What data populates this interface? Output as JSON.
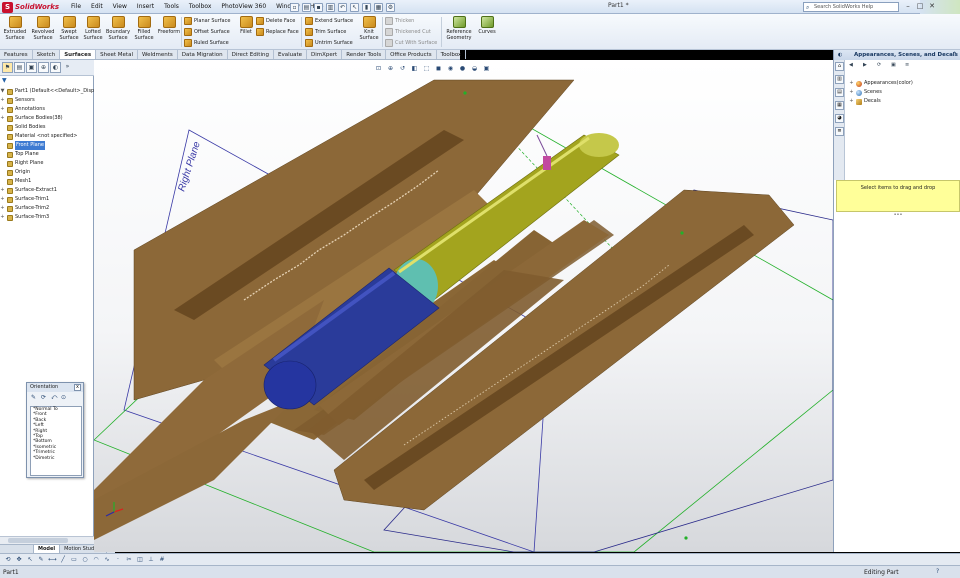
{
  "app": {
    "logo_text": "SolidWorks",
    "document_title": "Part1 *",
    "search_placeholder": "Search SolidWorks Help",
    "menu": [
      "File",
      "Edit",
      "View",
      "Insert",
      "Tools",
      "Toolbox",
      "PhotoView 360",
      "Window",
      "Help"
    ],
    "window_buttons": [
      "–",
      "□",
      "✕"
    ]
  },
  "ribbon": {
    "big_buttons": [
      {
        "label": "Extruded Surface"
      },
      {
        "label": "Revolved Surface"
      },
      {
        "label": "Swept Surface"
      },
      {
        "label": "Lofted Surface"
      },
      {
        "label": "Boundary Surface"
      },
      {
        "label": "Filled Surface"
      },
      {
        "label": "Freeform"
      }
    ],
    "col1": [
      "Planar Surface",
      "Offset Surface",
      "Ruled Surface"
    ],
    "fillet_label": "Fillet",
    "col2": [
      "Delete Face",
      "Replace Face"
    ],
    "col3": [
      "Extend Surface",
      "Trim Surface",
      "Untrim Surface"
    ],
    "knit_label": "Knit Surface",
    "col4": [
      "Thicken",
      "Thickened Cut",
      "Cut With Surface"
    ],
    "ref_geometry_label": "Reference Geometry",
    "curves_label": "Curves"
  },
  "command_tabs": [
    "Features",
    "Sketch",
    "Surfaces",
    "Sheet Metal",
    "Weldments",
    "Data Migration",
    "Direct Editing",
    "Evaluate",
    "DimXpert",
    "Render Tools",
    "Office Products",
    "Toolbox"
  ],
  "active_tab": "Surfaces",
  "feature_tree": {
    "items": [
      {
        "label": "Part1  (Default<<Default>_Disp",
        "selected": false,
        "expander": "▼"
      },
      {
        "label": "Sensors",
        "selected": false,
        "expander": "+"
      },
      {
        "label": "Annotations",
        "selected": false,
        "expander": "+"
      },
      {
        "label": "Surface Bodies(38)",
        "selected": false,
        "expander": "+"
      },
      {
        "label": "Solid Bodies",
        "selected": false,
        "expander": ""
      },
      {
        "label": "Material <not specified>",
        "selected": false,
        "expander": ""
      },
      {
        "label": "Front Plane",
        "selected": true,
        "expander": ""
      },
      {
        "label": "Top Plane",
        "selected": false,
        "expander": ""
      },
      {
        "label": "Right Plane",
        "selected": false,
        "expander": ""
      },
      {
        "label": "Origin",
        "selected": false,
        "expander": ""
      },
      {
        "label": "Mesh1",
        "selected": false,
        "expander": ""
      },
      {
        "label": "Surface-Extract1",
        "selected": false,
        "expander": "+"
      },
      {
        "label": "Surface-Trim1",
        "selected": false,
        "expander": "+"
      },
      {
        "label": "Surface-Trim2",
        "selected": false,
        "expander": "+"
      },
      {
        "label": "Surface-Trim3",
        "selected": false,
        "expander": "+"
      }
    ]
  },
  "bottom_tabs": [
    "",
    "Model",
    "Motion Study 1"
  ],
  "viewport": {
    "plane_label": "Right Plane"
  },
  "orientation": {
    "title": "Orientation",
    "close": "x",
    "views": [
      "*Normal To",
      "*Front",
      "*Back",
      "*Left",
      "*Right",
      "*Top",
      "*Bottom",
      "*Isometric",
      "*Trimetric",
      "*Dimetric"
    ]
  },
  "task_pane": {
    "title": "Appearances, Scenes, and Decals",
    "items": [
      "Appearances(color)",
      "Scenes",
      "Decals"
    ],
    "drag_hint": "Select items to drag and drop"
  },
  "status": {
    "left": "Part1",
    "right": "Editing Part",
    "help": "?"
  },
  "colors": {
    "surface_brown": "#8c6838",
    "cylinder_blue": "#2a3b9a",
    "cylinder_olive": "#a3a41e",
    "selection_blue": "#3e7bd2",
    "drag_hint_bg": "#ffff99"
  }
}
